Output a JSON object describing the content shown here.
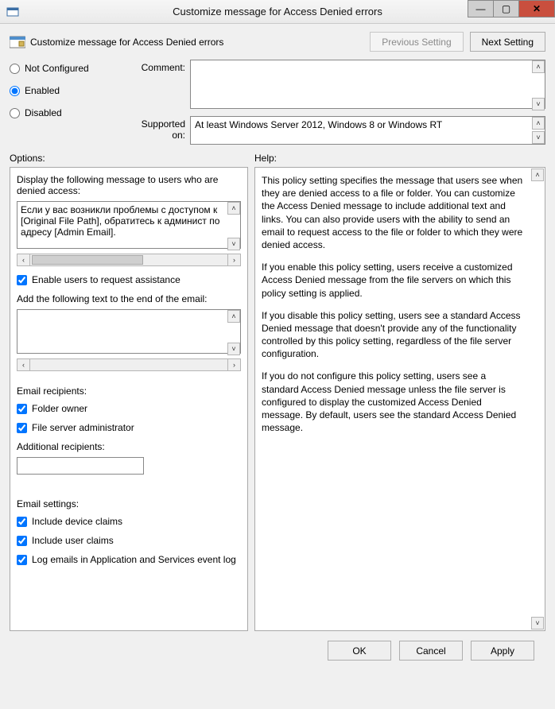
{
  "window": {
    "title": "Customize message for Access Denied errors"
  },
  "heading": {
    "text": "Customize message for Access Denied errors"
  },
  "nav": {
    "previous": "Previous Setting",
    "next": "Next Setting"
  },
  "state_radios": {
    "not_configured": "Not Configured",
    "enabled": "Enabled",
    "disabled": "Disabled",
    "selected": "enabled"
  },
  "labels": {
    "comment": "Comment:",
    "supported_on": "Supported on:",
    "options": "Options:",
    "help": "Help:"
  },
  "supported_on_value": "At least Windows Server 2012, Windows 8 or Windows RT",
  "options": {
    "display_message_label": "Display the following message to users who are denied access:",
    "display_message_value": "Если у вас возникли проблемы с доступом к [Original File Path], обратитесь к админист по адресу [Admin Email].",
    "enable_request_assistance": {
      "label": "Enable users to request assistance",
      "checked": true
    },
    "email_text_label": "Add the following text to the end of the email:",
    "email_text_value": "",
    "email_recipients_label": "Email recipients:",
    "folder_owner": {
      "label": "Folder owner",
      "checked": true
    },
    "file_server_admin": {
      "label": "File server administrator",
      "checked": true
    },
    "additional_recipients_label": "Additional recipients:",
    "additional_recipients_value": "",
    "email_settings_label": "Email settings:",
    "include_device_claims": {
      "label": "Include device claims",
      "checked": true
    },
    "include_user_claims": {
      "label": "Include user claims",
      "checked": true
    },
    "log_emails": {
      "label": "Log emails in Application and Services event log",
      "checked": true
    }
  },
  "help_text": {
    "p1": "This policy setting specifies the message that users see when they are denied access to a file or folder. You can customize the Access Denied message to include additional text and links. You can also provide users with the ability to send an email to request access to the file or folder to which they were denied access.",
    "p2": "If you enable this policy setting, users receive a customized Access Denied message from the file servers on which this policy setting is applied.",
    "p3": "If you disable this policy setting, users see a standard Access Denied message that doesn't provide any of the functionality controlled by this policy setting, regardless of the file server configuration.",
    "p4": "If you do not configure this policy setting, users see a standard Access Denied message unless the file server is configured to display the customized Access Denied message. By default, users see the standard Access Denied message."
  },
  "footer": {
    "ok": "OK",
    "cancel": "Cancel",
    "apply": "Apply"
  }
}
